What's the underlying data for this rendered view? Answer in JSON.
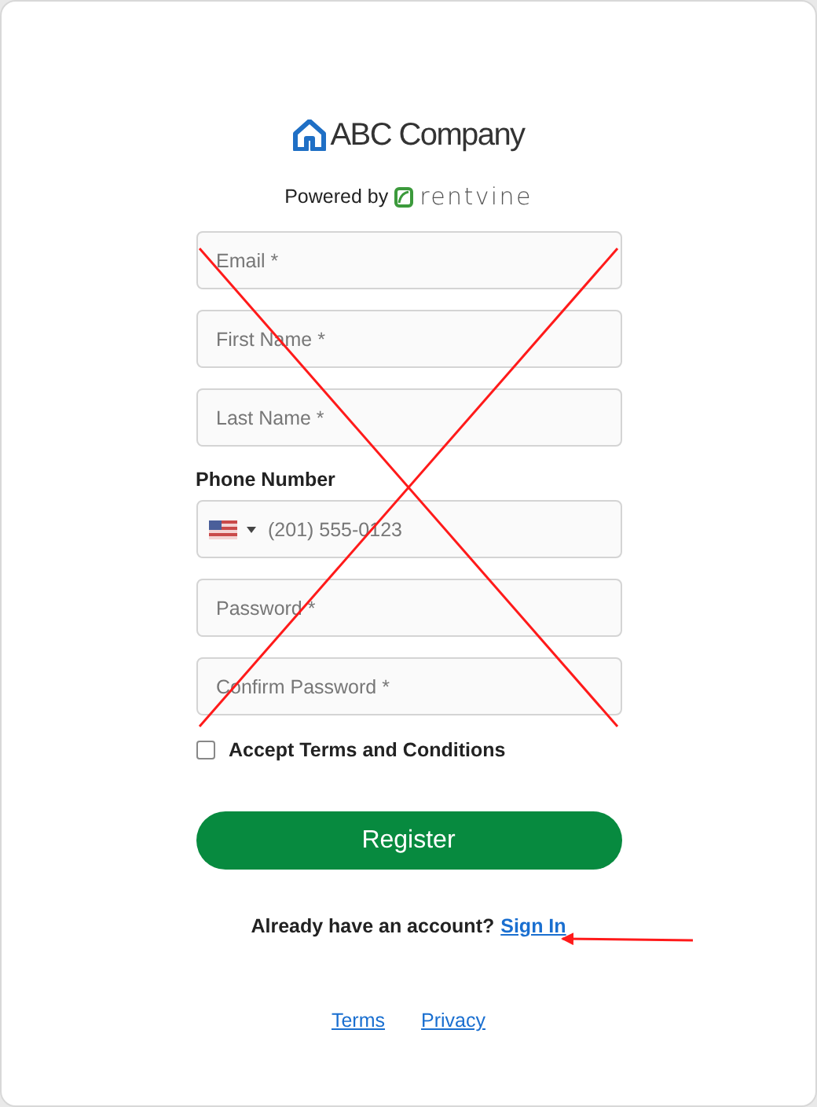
{
  "brand": {
    "name": "ABC Company",
    "powered_label": "Powered by",
    "powered_brand": "rentvine"
  },
  "fields": [
    {
      "kind": "text",
      "placeholder": "Email *"
    },
    {
      "kind": "text",
      "placeholder": "First Name *"
    },
    {
      "kind": "text",
      "placeholder": "Last Name *"
    },
    {
      "kind": "phone",
      "label": "Phone Number",
      "placeholder": "(201) 555-0123"
    },
    {
      "kind": "password",
      "placeholder": "Password *"
    },
    {
      "kind": "password",
      "placeholder": "Confirm Password *"
    }
  ],
  "terms_checkbox": {
    "label": "Accept Terms and Conditions",
    "checked": false
  },
  "register_button": "Register",
  "signin": {
    "prompt": "Already have an account?",
    "link": "Sign In"
  },
  "footer_links": [
    "Terms",
    "Privacy"
  ],
  "annotations": {
    "cross_out_form": true,
    "arrow_to_sign_in": true
  }
}
